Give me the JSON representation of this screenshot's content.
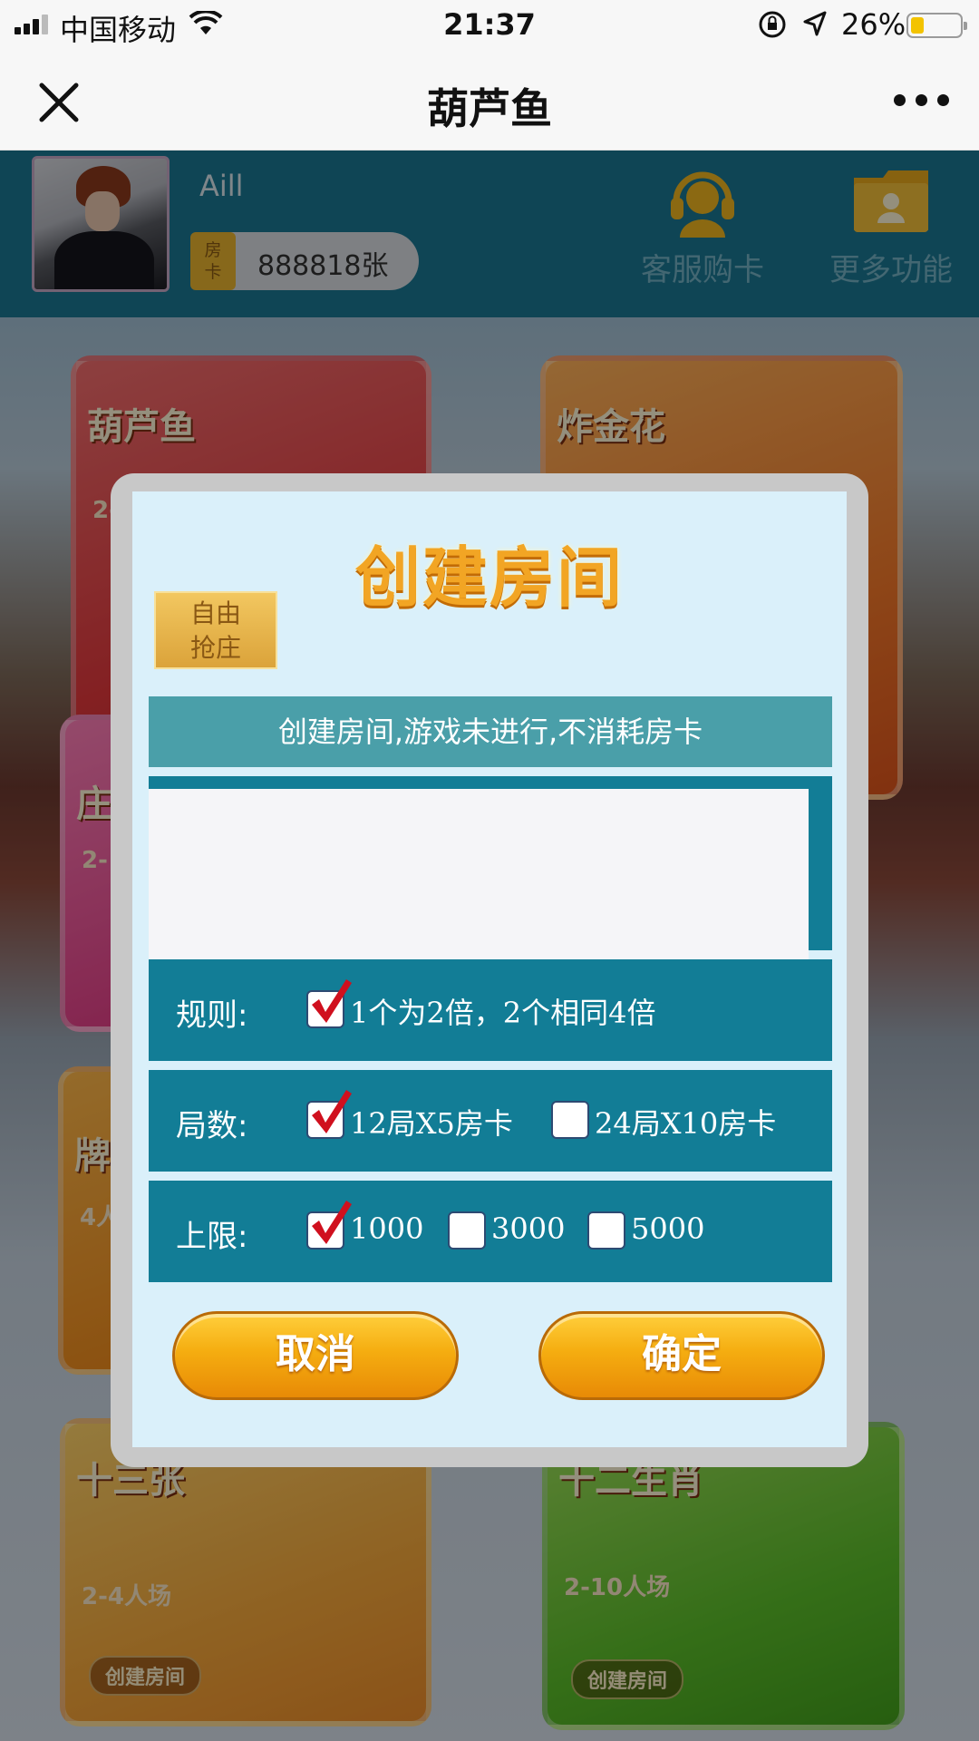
{
  "status_bar": {
    "carrier": "中国移动",
    "time": "21:37",
    "battery_percent": "26%",
    "battery_level": 0.26,
    "battery_color": "#f3c300"
  },
  "nav": {
    "title": "葫芦鱼",
    "close_icon": "close-icon",
    "more_icon": "more-dots-icon"
  },
  "profile": {
    "username": "Aill",
    "card_tag": "房卡",
    "card_tag_line1": "房",
    "card_tag_line2": "卡",
    "card_count": "888818张"
  },
  "top_actions": {
    "support_label": "客服购卡",
    "more_label": "更多功能"
  },
  "games": [
    {
      "name": "葫芦鱼",
      "players": "2-"
    },
    {
      "name": "炸金花",
      "players": ""
    },
    {
      "name": "庄",
      "players": "2-"
    },
    {
      "name": "牌",
      "players": "4人"
    },
    {
      "name": "十三张",
      "players": "2-4人场",
      "create": "创建房间"
    },
    {
      "name": "十二生肖",
      "players": "2-10人场",
      "create": "创建房间"
    }
  ],
  "modal": {
    "title": "创建房间",
    "mode_tab_line1": "自由",
    "mode_tab_line2": "抢庄",
    "notice": "创建房间,游戏未进行,不消耗房卡",
    "rows": [
      {
        "label": "规则:",
        "options": [
          {
            "text": "1个为2倍，2个相同4倍",
            "checked": true
          }
        ]
      },
      {
        "label": "局数:",
        "options": [
          {
            "text": "12局X5房卡",
            "checked": true
          },
          {
            "text": "24局X10房卡",
            "checked": false
          }
        ]
      },
      {
        "label": "上限:",
        "options": [
          {
            "text": "1000",
            "checked": true
          },
          {
            "text": "3000",
            "checked": false
          },
          {
            "text": "5000",
            "checked": false
          }
        ]
      }
    ],
    "cancel_label": "取消",
    "ok_label": "确定"
  },
  "colors": {
    "accent_orange": "#f5ad10",
    "panel_teal": "#127d96",
    "check_red": "#d0101e"
  }
}
